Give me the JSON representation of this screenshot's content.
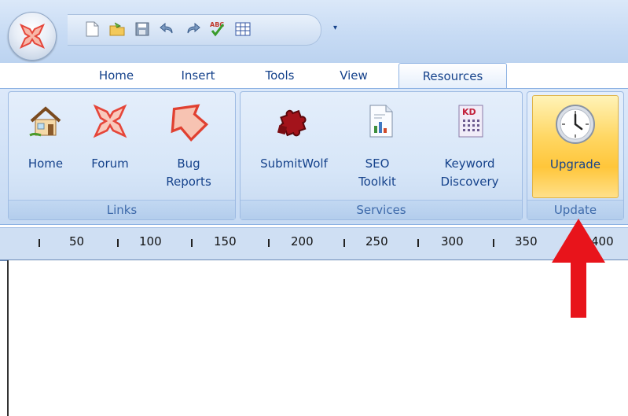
{
  "tabs": [
    {
      "label": "Home"
    },
    {
      "label": "Insert"
    },
    {
      "label": "Tools"
    },
    {
      "label": "View"
    },
    {
      "label": "Resources",
      "active": true
    }
  ],
  "quick_access": [
    "new-document-icon",
    "open-folder-icon",
    "save-icon",
    "undo-icon",
    "redo-icon",
    "spellcheck-icon",
    "table-icon"
  ],
  "groups": {
    "links": {
      "label": "Links",
      "buttons": [
        {
          "label": "Home",
          "icon": "house-icon"
        },
        {
          "label": "Forum",
          "icon": "forum-icon"
        },
        {
          "label": "Bug\nReports",
          "icon": "bug-reports-icon"
        }
      ]
    },
    "services": {
      "label": "Services",
      "buttons": [
        {
          "label": "SubmitWolf",
          "icon": "puzzle-icon"
        },
        {
          "label": "SEO\nToolkit",
          "icon": "chart-document-icon"
        },
        {
          "label": "Keyword\nDiscovery",
          "icon": "keyword-discovery-icon"
        }
      ]
    },
    "update": {
      "label": "Update",
      "buttons": [
        {
          "label": "Upgrade",
          "icon": "clock-icon",
          "highlighted": true
        }
      ]
    }
  },
  "ruler": {
    "numbers": [
      "50",
      "100",
      "150",
      "200",
      "250",
      "300",
      "350",
      "400"
    ]
  },
  "icon_texts": {
    "spellcheck": "ABC",
    "keyword_discovery": "KD"
  },
  "colors": {
    "ribbon_text": "#15428b",
    "highlight": "#ffc63a",
    "annotation_arrow": "#e8141b"
  }
}
